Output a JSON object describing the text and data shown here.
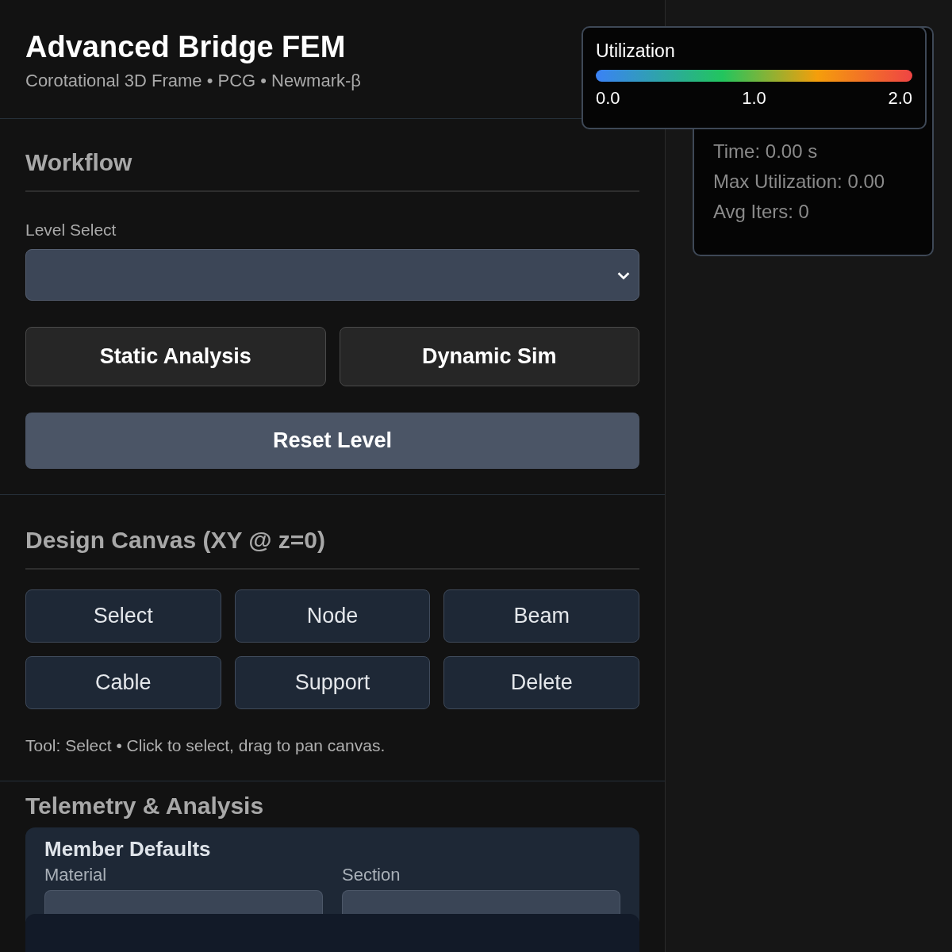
{
  "header": {
    "title": "Advanced Bridge FEM",
    "subtitle": "Corotational 3D Frame • PCG • Newmark-β"
  },
  "workflow": {
    "heading": "Workflow",
    "level_select": {
      "label": "Level Select"
    },
    "buttons": [
      "Static Analysis",
      "Dynamic Sim"
    ],
    "reset_button": "Reset Level"
  },
  "design_canvas": {
    "heading": "Design Canvas (XY @ z=0)",
    "tools": [
      "Select",
      "Node",
      "Beam",
      "Cable",
      "Support",
      "Delete"
    ],
    "hint": "Tool: Select • Click to select, drag to pan canvas."
  },
  "telemetry": {
    "heading": "Telemetry & Analysis"
  },
  "member_defaults": {
    "title": "Member Defaults",
    "fields": [
      {
        "label": "Material"
      },
      {
        "label": "Section"
      }
    ]
  },
  "legend": {
    "title": "Utilization",
    "ticks": [
      "0.0",
      "1.0",
      "2.0"
    ]
  },
  "stats": [
    "Time: 0.00 s",
    "Max Utilization: 0.00",
    "Avg Iters: 0"
  ]
}
